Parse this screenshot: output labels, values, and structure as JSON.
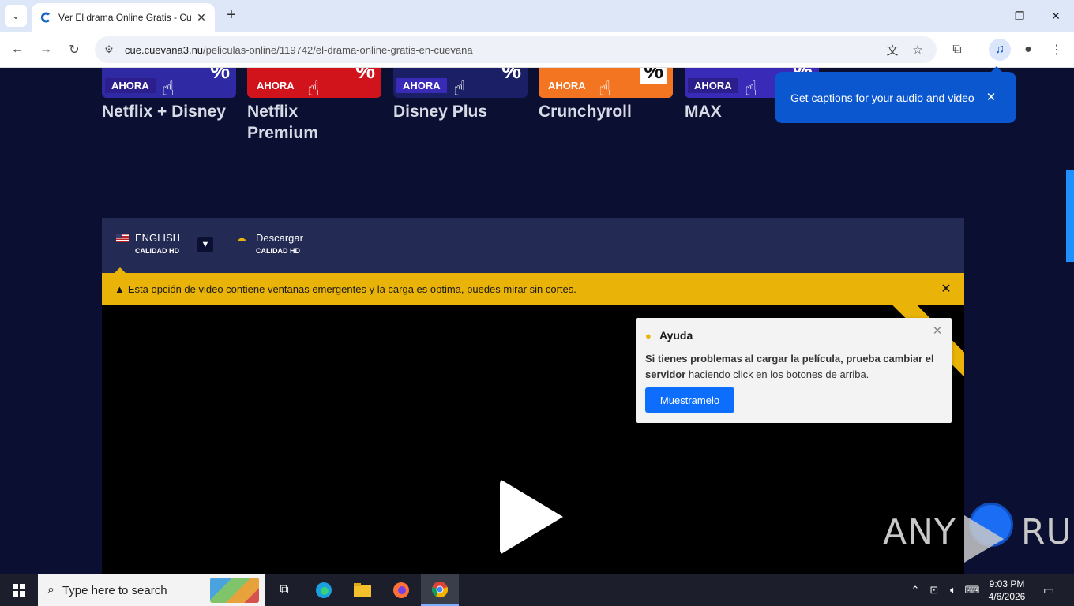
{
  "browser": {
    "tab_title": "Ver El drama Online Gratis - Cu",
    "url_host": "cue.cuevana3.nu",
    "url_path": "/peliculas-online/119742/el-drama-online-gratis-en-cuevana"
  },
  "promos": [
    {
      "badge": "AHORA",
      "name": "Netflix + Disney",
      "color": "#2f2aa3"
    },
    {
      "badge": "AHORA",
      "name": "Netflix Premium",
      "color": "#d1141c"
    },
    {
      "badge": "AHORA",
      "name": "Disney Plus",
      "color": "#1a1f66"
    },
    {
      "badge": "AHORA",
      "name": "Crunchyroll",
      "color": "#f47521"
    },
    {
      "badge": "AHORA",
      "name": "MAX",
      "color": "#3a2ab8"
    }
  ],
  "captions_popup": {
    "text": "Get captions for your audio and video"
  },
  "player": {
    "language": {
      "title": "ENGLISH",
      "quality": "CALIDAD HD"
    },
    "download": {
      "title": "Descargar",
      "quality": "CALIDAD HD"
    },
    "warning": "Esta opción de video contiene ventanas emergentes y la carga es optima, puedes mirar sin cortes."
  },
  "help": {
    "title": "Ayuda",
    "body_bold": "Si tienes problemas al cargar la película, prueba cambiar el servidor",
    "body_rest": " haciendo click en los botones de arriba.",
    "button": "Muestramelo"
  },
  "watermark": {
    "left": "ANY",
    "right": "RUN"
  },
  "taskbar": {
    "search_placeholder": "Type here to search",
    "time": "9:03 PM",
    "date": "4/6/2026"
  },
  "colors": {
    "accent_yellow": "#e9b308",
    "page_bg": "#0b1033",
    "popup_blue": "#0b57d0",
    "button_blue": "#0d6efd"
  }
}
